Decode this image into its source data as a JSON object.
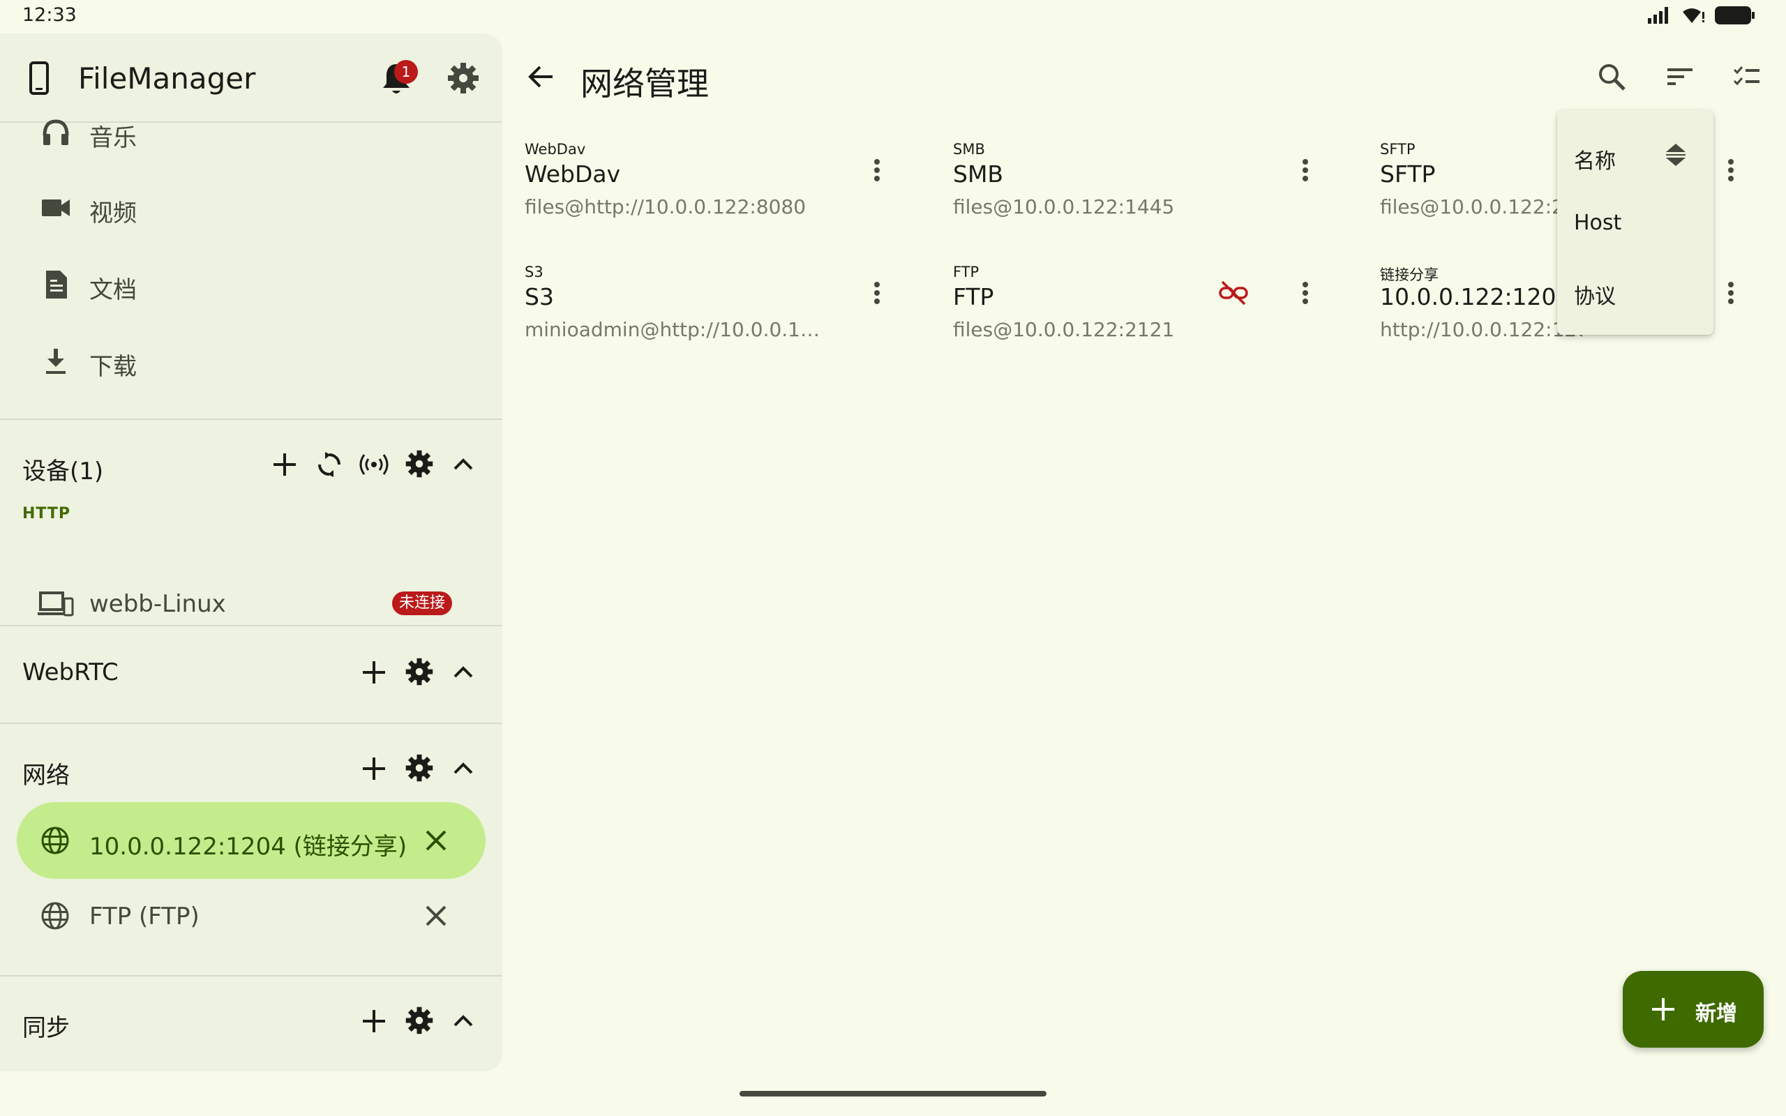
{
  "status_bar": {
    "time": "12:33"
  },
  "drawer": {
    "app_title": "FileManager",
    "notification_count": "1",
    "nav_items": [
      {
        "label": "音乐",
        "icon": "headphones-icon"
      },
      {
        "label": "视频",
        "icon": "videocam-icon"
      },
      {
        "label": "文档",
        "icon": "document-icon"
      },
      {
        "label": "下载",
        "icon": "download-icon"
      }
    ],
    "devices": {
      "title": "设备(1)",
      "protocol": "HTTP",
      "items": [
        {
          "label": "webb-Linux",
          "status": "未连接"
        }
      ]
    },
    "webrtc": {
      "title": "WebRTC"
    },
    "network": {
      "title": "网络",
      "items": [
        {
          "label": "10.0.0.122:1204 (链接分享)",
          "active": true
        },
        {
          "label": "FTP (FTP)",
          "active": false
        }
      ]
    },
    "sync": {
      "title": "同步"
    }
  },
  "main": {
    "title": "网络管理",
    "cards": [
      {
        "protocol": "WebDav",
        "name": "WebDav",
        "address": "files@http://10.0.0.122:8080"
      },
      {
        "protocol": "SMB",
        "name": "SMB",
        "address": "files@10.0.0.122:1445"
      },
      {
        "protocol": "SFTP",
        "name": "SFTP",
        "address": "files@10.0.0.122:22"
      },
      {
        "protocol": "S3",
        "name": "S3",
        "address": "minioadmin@http://10.0.0.122:…"
      },
      {
        "protocol": "FTP",
        "name": "FTP",
        "address": "files@10.0.0.122:2121",
        "disconnected": true
      },
      {
        "protocol": "链接分享",
        "name": "10.0.0.122:1204",
        "address": "http://10.0.0.122:1204"
      }
    ],
    "sort_menu": {
      "items": [
        "名称",
        "Host",
        "协议"
      ]
    },
    "fab": {
      "label": "新增"
    }
  },
  "colors": {
    "accent": "#3f6a00",
    "active_bg": "#c4ec8c",
    "error": "#ba1a1a",
    "background": "#f8fbea",
    "drawer_bg": "#eef2e0"
  }
}
